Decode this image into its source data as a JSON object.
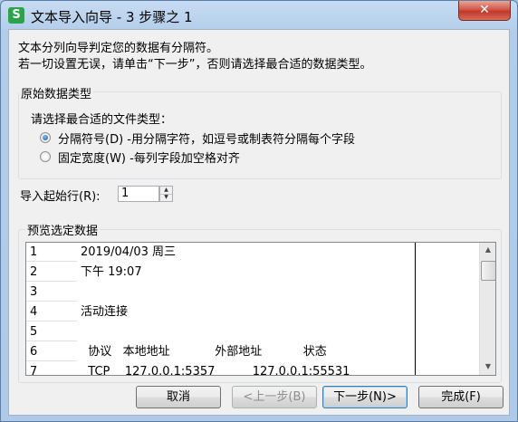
{
  "window": {
    "icon_letter": "S",
    "title": "文本导入向导 - 3 步骤之 1",
    "close_glyph": "✕"
  },
  "intro": {
    "line1": "文本分列向导判定您的数据有分隔符。",
    "line2": "若一切设置无误，请单击“下一步”，否则请选择最合适的数据类型。"
  },
  "original_type": {
    "label": "原始数据类型",
    "prompt": "请选择最合适的文件类型：",
    "options": [
      {
        "label": "分隔符号(D)  -用分隔字符，如逗号或制表符分隔每个字段",
        "selected": true
      },
      {
        "label": "固定宽度(W)  -每列字段加空格对齐",
        "selected": false
      }
    ]
  },
  "start_row": {
    "label": "导入起始行(R):",
    "value": "1"
  },
  "preview": {
    "label": "预览选定数据",
    "rows": [
      {
        "num": "1",
        "text": "2019/04/03 周三"
      },
      {
        "num": "2",
        "text": "下午 19:07"
      },
      {
        "num": "3",
        "text": ""
      },
      {
        "num": "4",
        "text": "活动连接"
      },
      {
        "num": "5",
        "text": ""
      },
      {
        "num": "6",
        "text": "  协议   本地地址            外部地址           状态"
      },
      {
        "num": "7",
        "text": "  TCP    127.0.0.1:5357          127.0.0.1:55531"
      }
    ]
  },
  "buttons": {
    "cancel": "取消",
    "back": "<上一步(B)",
    "next": "下一步(N)>",
    "finish": "完成(F)"
  },
  "icons": {
    "scroll_up": "▲",
    "scroll_down": "▼",
    "spin_up": "▲",
    "spin_down": "▼"
  }
}
